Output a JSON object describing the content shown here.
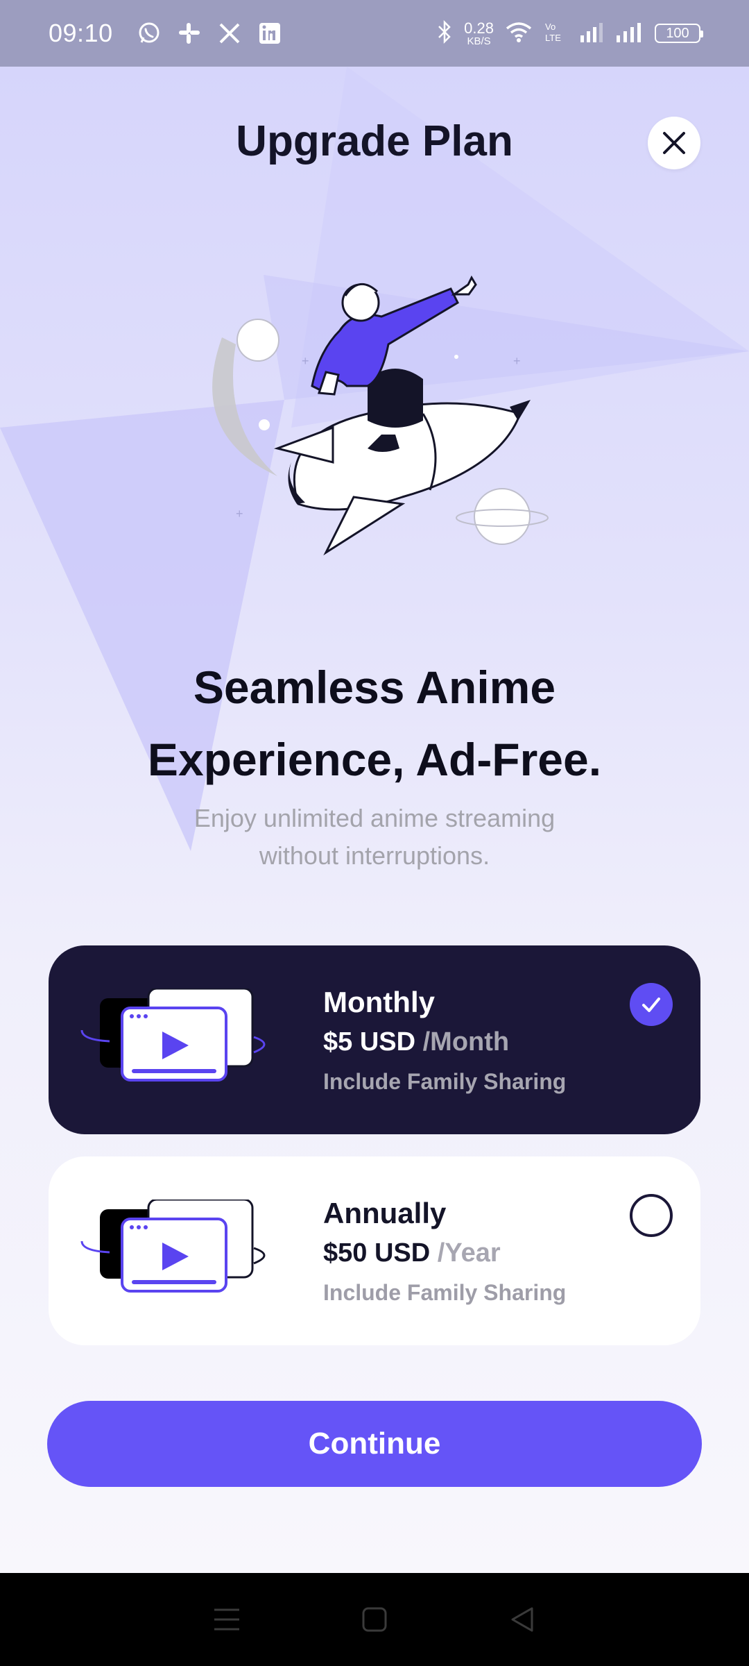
{
  "status_bar": {
    "time": "09:10",
    "app_icons": [
      "whatsapp-icon",
      "slack-icon",
      "x-icon",
      "linkedin-icon"
    ],
    "net_speed_value": "0.28",
    "net_speed_unit": "KB/S",
    "battery": "100"
  },
  "header": {
    "title": "Upgrade Plan"
  },
  "hero": {
    "headline_line1": "Seamless Anime",
    "headline_line2": "Experience, Ad-Free.",
    "subtext_line1": "Enjoy unlimited anime streaming",
    "subtext_line2": "without interruptions."
  },
  "plans": [
    {
      "name": "Monthly",
      "amount": "$5 USD",
      "period": "/Month",
      "extra": "Include Family Sharing",
      "selected": true
    },
    {
      "name": "Annually",
      "amount": "$50 USD",
      "period": "/Year",
      "extra": "Include Family Sharing",
      "selected": false
    }
  ],
  "continue_label": "Continue",
  "colors": {
    "accent": "#6554f7",
    "selected_card": "#1b1738",
    "check": "#5f4df3"
  }
}
